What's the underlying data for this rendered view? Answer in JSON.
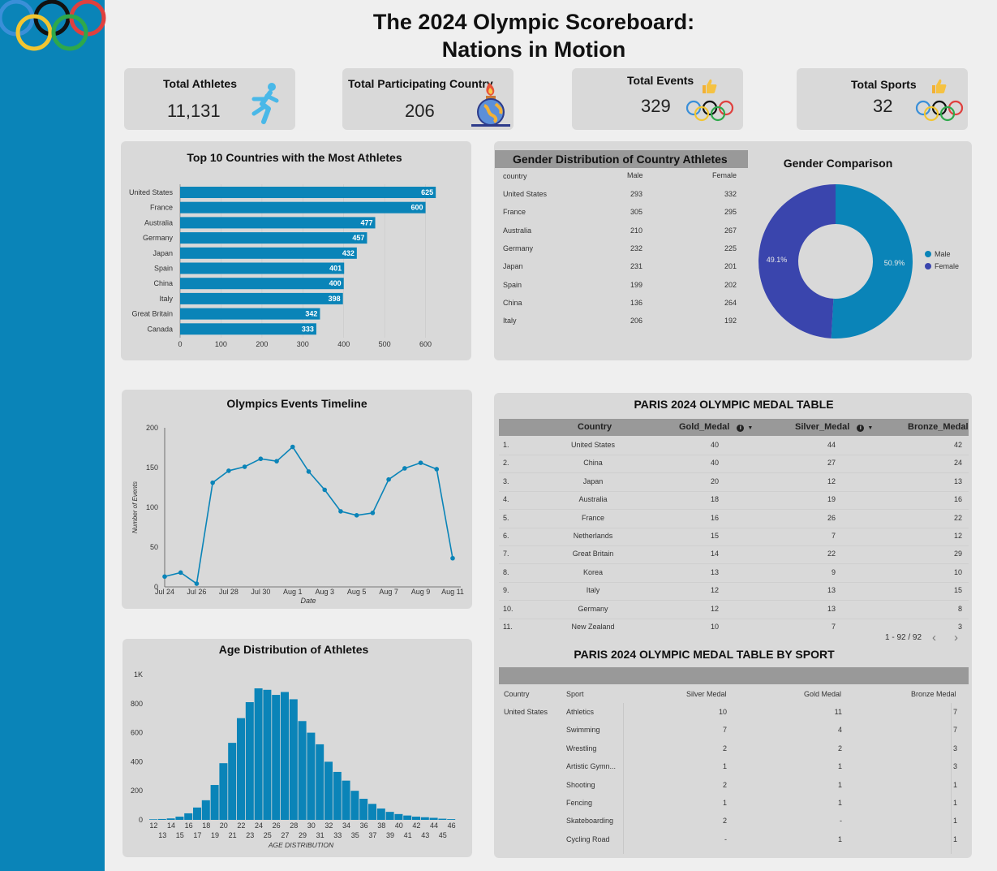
{
  "dashboard": {
    "title_line1": "The 2024 Olympic Scoreboard:",
    "title_line2": "Nations in Motion"
  },
  "kpis": {
    "athletes": {
      "label": "Total Athletes",
      "value": "11,131",
      "icon": "runner-icon"
    },
    "countries": {
      "label": "Total Participating Country",
      "value": "206",
      "icon": "torch-globe-icon"
    },
    "events": {
      "label": "Total Events",
      "value": "329",
      "icon": "thumbs-up-icon"
    },
    "sports": {
      "label": "Total Sports",
      "value": "32",
      "icon": "thumbs-up-icon"
    }
  },
  "colors": {
    "primary": "#0a84b8",
    "female": "#3a45ad",
    "panel": "#d9d9d9",
    "page": "#efefef"
  },
  "top10": {
    "title": "Top 10 Countries with the Most Athletes",
    "type": "bar",
    "categories": [
      "United States",
      "France",
      "Australia",
      "Germany",
      "Japan",
      "Spain",
      "China",
      "Italy",
      "Great Britain",
      "Canada"
    ],
    "values": [
      625,
      600,
      477,
      457,
      432,
      401,
      400,
      398,
      342,
      333
    ],
    "ticks": [
      "0",
      "100",
      "200",
      "300",
      "400",
      "500",
      "600"
    ],
    "xlim": [
      0,
      700
    ]
  },
  "gender_table": {
    "title": "Gender Distribution of Country Athletes",
    "headers": [
      "country",
      "Male",
      "Female"
    ],
    "rows": [
      [
        "United States",
        "293",
        "332"
      ],
      [
        "France",
        "305",
        "295"
      ],
      [
        "Australia",
        "210",
        "267"
      ],
      [
        "Germany",
        "232",
        "225"
      ],
      [
        "Japan",
        "231",
        "201"
      ],
      [
        "Spain",
        "199",
        "202"
      ],
      [
        "China",
        "136",
        "264"
      ],
      [
        "Italy",
        "206",
        "192"
      ]
    ]
  },
  "gender_pie": {
    "title": "Gender Comparison",
    "type": "pie",
    "labels": [
      "Male",
      "Female"
    ],
    "values": [
      50.9,
      49.1
    ],
    "value_labels": [
      "50.9%",
      "49.1%"
    ],
    "legend": "right"
  },
  "timeline": {
    "title": "Olympics Events Timeline",
    "type": "line",
    "xlabel": "Date",
    "ylabel": "Number of Events",
    "ylim": [
      0,
      200
    ],
    "yticks": [
      "0",
      "50",
      "100",
      "150",
      "200"
    ],
    "xticks": [
      "Jul 24",
      "Jul 26",
      "Jul 28",
      "Jul 30",
      "Aug 1",
      "Aug 3",
      "Aug 5",
      "Aug 7",
      "Aug 9",
      "Aug 11"
    ],
    "x": [
      "Jul 24",
      "Jul 25",
      "Jul 26",
      "Jul 27",
      "Jul 28",
      "Jul 29",
      "Jul 30",
      "Jul 31",
      "Aug 1",
      "Aug 2",
      "Aug 3",
      "Aug 4",
      "Aug 5",
      "Aug 6",
      "Aug 7",
      "Aug 8",
      "Aug 9",
      "Aug 10",
      "Aug 11"
    ],
    "values": [
      13,
      18,
      4,
      131,
      146,
      151,
      161,
      158,
      176,
      145,
      122,
      95,
      90,
      93,
      135,
      149,
      156,
      148,
      36
    ]
  },
  "age": {
    "title": "Age Distribution of Athletes",
    "type": "bar",
    "xlabel": "AGE DISTRIBUTION",
    "ylim": [
      0,
      1000
    ],
    "yticks": [
      "0",
      "200",
      "400",
      "600",
      "800",
      "1K"
    ],
    "ages": [
      12,
      13,
      14,
      15,
      16,
      17,
      18,
      19,
      20,
      21,
      22,
      23,
      24,
      25,
      26,
      27,
      28,
      29,
      30,
      31,
      32,
      33,
      34,
      35,
      36,
      37,
      38,
      39,
      40,
      41,
      42,
      43,
      44,
      45,
      46
    ],
    "values": [
      4,
      6,
      10,
      22,
      45,
      85,
      135,
      240,
      390,
      530,
      700,
      810,
      905,
      895,
      860,
      880,
      830,
      680,
      600,
      520,
      400,
      330,
      270,
      200,
      145,
      110,
      78,
      55,
      40,
      30,
      22,
      18,
      14,
      8,
      5
    ],
    "labels_top": [
      "12",
      "14",
      "16",
      "18",
      "20",
      "22",
      "24",
      "26",
      "28",
      "30",
      "32",
      "34",
      "36",
      "38",
      "40",
      "42",
      "44",
      "46"
    ],
    "labels_bottom": [
      "13",
      "15",
      "17",
      "19",
      "21",
      "23",
      "25",
      "27",
      "29",
      "31",
      "33",
      "35",
      "37",
      "39",
      "41",
      "43",
      "45"
    ]
  },
  "medal_table": {
    "title": "PARIS 2024 OLYMPIC MEDAL TABLE",
    "headers": [
      "Country",
      "Gold_Medal",
      "Silver_Medal",
      "Bronze_Medal"
    ],
    "rows": [
      [
        "1.",
        "United States",
        "40",
        "44",
        "42"
      ],
      [
        "2.",
        "China",
        "40",
        "27",
        "24"
      ],
      [
        "3.",
        "Japan",
        "20",
        "12",
        "13"
      ],
      [
        "4.",
        "Australia",
        "18",
        "19",
        "16"
      ],
      [
        "5.",
        "France",
        "16",
        "26",
        "22"
      ],
      [
        "6.",
        "Netherlands",
        "15",
        "7",
        "12"
      ],
      [
        "7.",
        "Great Britain",
        "14",
        "22",
        "29"
      ],
      [
        "8.",
        "Korea",
        "13",
        "9",
        "10"
      ],
      [
        "9.",
        "Italy",
        "12",
        "13",
        "15"
      ],
      [
        "10.",
        "Germany",
        "12",
        "13",
        "8"
      ],
      [
        "11.",
        "New Zealand",
        "10",
        "7",
        "3"
      ]
    ],
    "pagination": "1 - 92 / 92"
  },
  "sport_table": {
    "title": "PARIS 2024 OLYMPIC MEDAL TABLE BY SPORT",
    "headers": [
      "Country",
      "Sport",
      "Silver Medal",
      "Gold Medal",
      "Bronze Medal"
    ],
    "country": "United States",
    "rows": [
      [
        "Athletics",
        "10",
        "11",
        "7"
      ],
      [
        "Swimming",
        "7",
        "4",
        "7"
      ],
      [
        "Wrestling",
        "2",
        "2",
        "3"
      ],
      [
        "Artistic Gymn...",
        "1",
        "1",
        "3"
      ],
      [
        "Shooting",
        "2",
        "1",
        "1"
      ],
      [
        "Fencing",
        "1",
        "1",
        "1"
      ],
      [
        "Skateboarding",
        "2",
        "-",
        "1"
      ],
      [
        "Cycling Road",
        "-",
        "1",
        "1"
      ]
    ]
  }
}
